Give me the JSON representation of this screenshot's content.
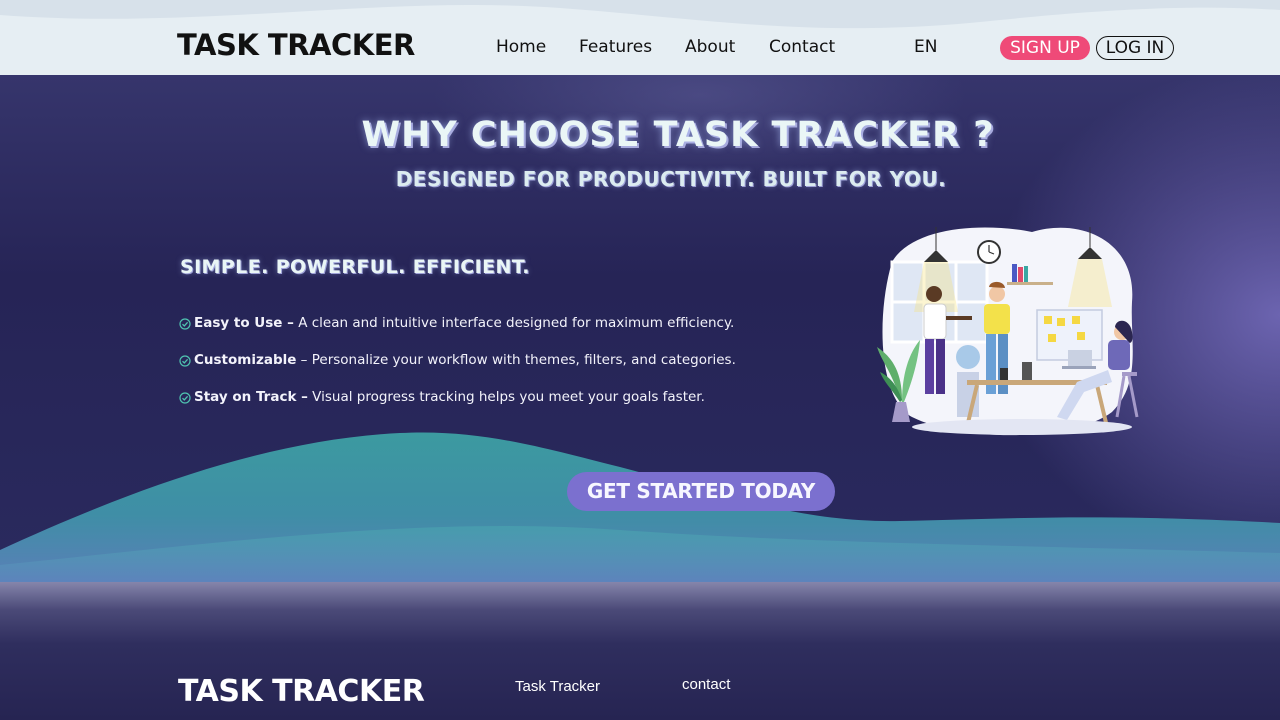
{
  "header": {
    "logo": "TASK TRACKER",
    "nav": [
      {
        "label": "Home"
      },
      {
        "label": "Features"
      },
      {
        "label": "About"
      },
      {
        "label": "Contact"
      }
    ],
    "language": "EN",
    "signup_label": "SIGN UP",
    "login_label": "LOG IN"
  },
  "hero": {
    "title": "WHY CHOOSE TASK TRACKER ?",
    "subtitle": "DESIGNED FOR PRODUCTIVITY. BUILT FOR YOU.",
    "tagline": "SIMPLE. POWERFUL. EFFICIENT.",
    "features": [
      {
        "title": "Easy to Use –",
        "text": " A clean and intuitive interface designed for maximum efficiency."
      },
      {
        "title": "Customizable",
        "text": " – Personalize your workflow with themes, filters, and categories."
      },
      {
        "title": "Stay on Track –",
        "text": " Visual progress tracking helps you meet your goals faster."
      }
    ],
    "cta_label": "GET STARTED TODAY",
    "illustration_icon": "office-team-illustration"
  },
  "footer": {
    "logo": "TASK TRACKER",
    "link1": "Task Tracker",
    "link2": "contact"
  },
  "colors": {
    "accent_pink": "#ef4a78",
    "cta_purple": "#7b70cf",
    "teal_wave": "#3f9a9e",
    "hero_bg": "#262456",
    "header_bg": "#e6eef3"
  }
}
